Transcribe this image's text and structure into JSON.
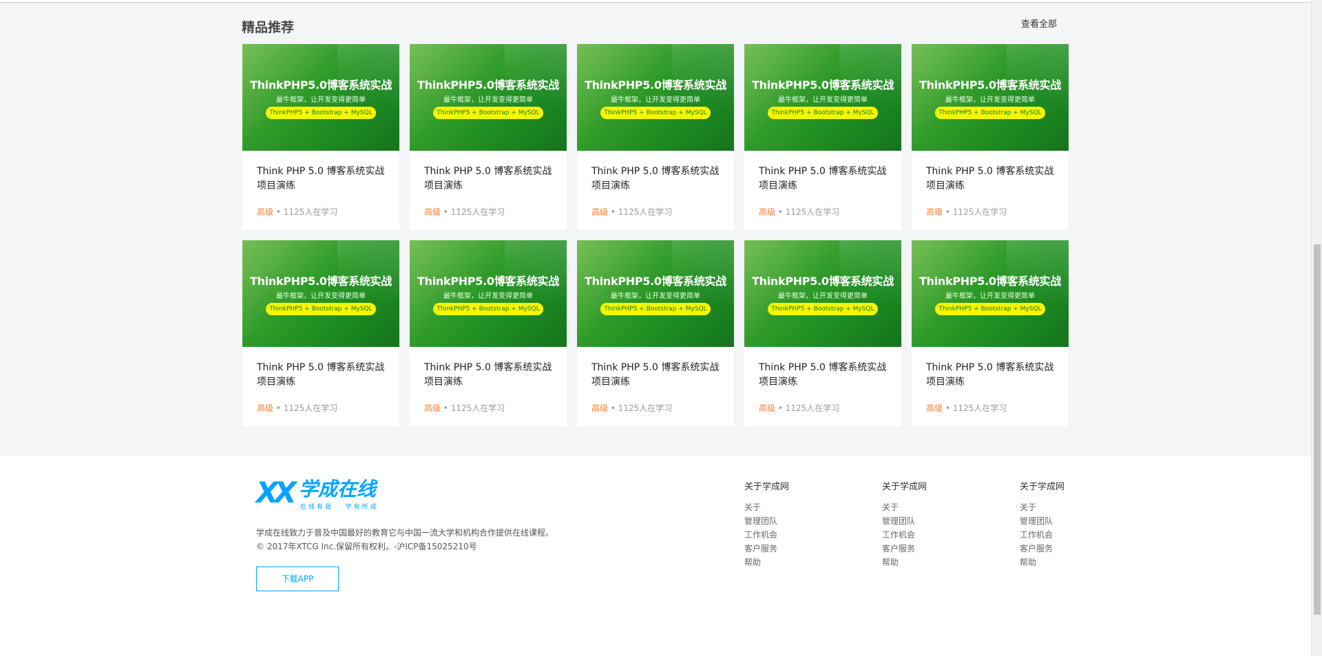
{
  "section": {
    "title": "精品推荐",
    "view_all": "查看全部"
  },
  "courses": [
    {
      "banner_title": "ThinkPHP5.0博客系统实战",
      "banner_sub": "最牛框架，让开发变得更简单",
      "banner_pill": "ThinkPHP5 + Bootstrap + MySQL",
      "title": "Think PHP 5.0 博客系统实战项目演练",
      "level": "高级",
      "sep": "•",
      "learners": "1125人在学习"
    },
    {
      "banner_title": "ThinkPHP5.0博客系统实战",
      "banner_sub": "最牛框架，让开发变得更简单",
      "banner_pill": "ThinkPHP5 + Bootstrap + MySQL",
      "title": "Think PHP 5.0 博客系统实战项目演练",
      "level": "高级",
      "sep": "•",
      "learners": "1125人在学习"
    },
    {
      "banner_title": "ThinkPHP5.0博客系统实战",
      "banner_sub": "最牛框架，让开发变得更简单",
      "banner_pill": "ThinkPHP5 + Bootstrap + MySQL",
      "title": "Think PHP 5.0 博客系统实战项目演练",
      "level": "高级",
      "sep": "•",
      "learners": "1125人在学习"
    },
    {
      "banner_title": "ThinkPHP5.0博客系统实战",
      "banner_sub": "最牛框架，让开发变得更简单",
      "banner_pill": "ThinkPHP5 + Bootstrap + MySQL",
      "title": "Think PHP 5.0 博客系统实战项目演练",
      "level": "高级",
      "sep": "•",
      "learners": "1125人在学习"
    },
    {
      "banner_title": "ThinkPHP5.0博客系统实战",
      "banner_sub": "最牛框架，让开发变得更简单",
      "banner_pill": "ThinkPHP5 + Bootstrap + MySQL",
      "title": "Think PHP 5.0 博客系统实战项目演练",
      "level": "高级",
      "sep": "•",
      "learners": "1125人在学习"
    },
    {
      "banner_title": "ThinkPHP5.0博客系统实战",
      "banner_sub": "最牛框架，让开发变得更简单",
      "banner_pill": "ThinkPHP5 + Bootstrap + MySQL",
      "title": "Think PHP 5.0 博客系统实战项目演练",
      "level": "高级",
      "sep": "•",
      "learners": "1125人在学习"
    },
    {
      "banner_title": "ThinkPHP5.0博客系统实战",
      "banner_sub": "最牛框架，让开发变得更简单",
      "banner_pill": "ThinkPHP5 + Bootstrap + MySQL",
      "title": "Think PHP 5.0 博客系统实战项目演练",
      "level": "高级",
      "sep": "•",
      "learners": "1125人在学习"
    },
    {
      "banner_title": "ThinkPHP5.0博客系统实战",
      "banner_sub": "最牛框架，让开发变得更简单",
      "banner_pill": "ThinkPHP5 + Bootstrap + MySQL",
      "title": "Think PHP 5.0 博客系统实战项目演练",
      "level": "高级",
      "sep": "•",
      "learners": "1125人在学习"
    },
    {
      "banner_title": "ThinkPHP5.0博客系统实战",
      "banner_sub": "最牛框架，让开发变得更简单",
      "banner_pill": "ThinkPHP5 + Bootstrap + MySQL",
      "title": "Think PHP 5.0 博客系统实战项目演练",
      "level": "高级",
      "sep": "•",
      "learners": "1125人在学习"
    },
    {
      "banner_title": "ThinkPHP5.0博客系统实战",
      "banner_sub": "最牛框架，让开发变得更简单",
      "banner_pill": "ThinkPHP5 + Bootstrap + MySQL",
      "title": "Think PHP 5.0 博客系统实战项目演练",
      "level": "高级",
      "sep": "•",
      "learners": "1125人在学习"
    }
  ],
  "footer": {
    "logo": {
      "mark": "XX",
      "name": "学成在线",
      "slogan": "在线有我 · 学有所成"
    },
    "desc_line1": "学成在线致力于普及中国最好的教育它与中国一流大学和机构合作提供在线课程。",
    "desc_line2": "© 2017年XTCG Inc.保留所有权利。-沪ICP备15025210号",
    "download": "下载APP",
    "columns": [
      {
        "title": "关于学成网",
        "links": [
          "关于",
          "管理团队",
          "工作机会",
          "客户服务",
          "帮助"
        ]
      },
      {
        "title": "关于学成网",
        "links": [
          "关于",
          "管理团队",
          "工作机会",
          "客户服务",
          "帮助"
        ]
      },
      {
        "title": "关于学成网",
        "links": [
          "关于",
          "管理团队",
          "工作机会",
          "客户服务",
          "帮助"
        ]
      }
    ]
  },
  "colors": {
    "accent": "#00a4ff",
    "level": "#ff7c2d",
    "banner_green": "#2f9b28",
    "pill_yellow": "#f6f600",
    "page_bg": "#f3f5f7"
  }
}
